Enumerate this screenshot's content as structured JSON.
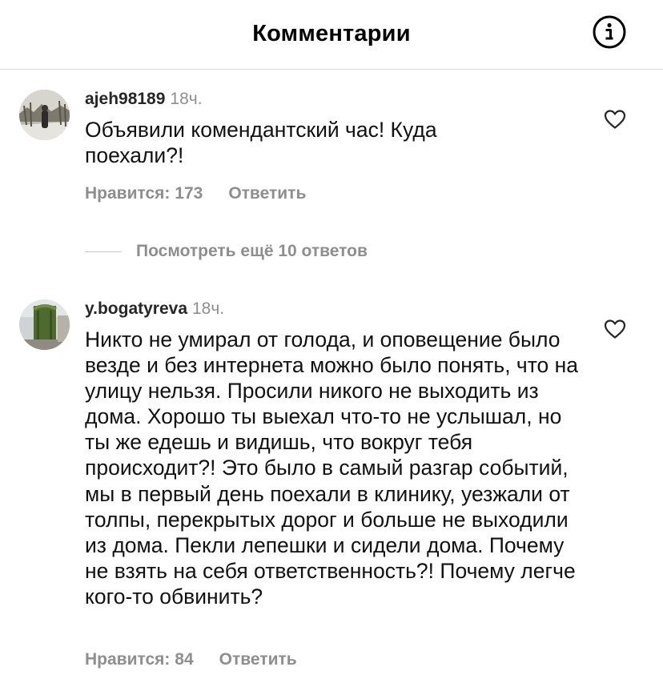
{
  "header": {
    "title": "Комментарии"
  },
  "comments": [
    {
      "username": "ajeh98189",
      "time": "18ч.",
      "text": "Объявили комендантский час! Куда поехали?!",
      "likes_label": "Нравится: 173",
      "reply_label": "Ответить"
    },
    {
      "username": "y.bogatyreva",
      "time": "18ч.",
      "text": "Никто не умирал от голода, и оповещение было везде и без интернета можно было понять, что на улицу нельзя. Просили никого не выходить из дома. Хорошо ты выехал что-то не услышал, но ты же едешь и видишь, что вокруг тебя происходит?! Это было в самый разгар событий, мы в первый день поехали в клинику, уезжали от толпы, перекрытых дорог и больше не выходили из дома. Пекли лепешки и сидели дома. Почему не взять на себя ответственность?! Почему легче кого-то обвинить?",
      "likes_label": "Нравится: 84",
      "reply_label": "Ответить"
    }
  ],
  "view_replies": {
    "label": "Посмотреть ещё 10 ответов"
  },
  "icons": {
    "info": "info-icon",
    "like": "heart-outline-icon"
  },
  "colors": {
    "secondary_text": "#8e8e8e",
    "divider": "#dbdbdb"
  }
}
